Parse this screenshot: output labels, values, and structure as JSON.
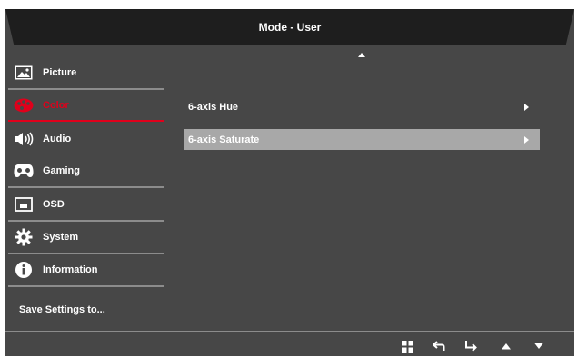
{
  "header": {
    "title": "Mode - User"
  },
  "sidebar": {
    "items": [
      {
        "label": "Picture",
        "icon": "picture-icon"
      },
      {
        "label": "Color",
        "icon": "color-palette-icon",
        "active": true
      },
      {
        "label": "Audio",
        "icon": "speaker-icon"
      },
      {
        "label": "Gaming",
        "icon": "gamepad-icon"
      },
      {
        "label": "OSD",
        "icon": "osd-window-icon"
      },
      {
        "label": "System",
        "icon": "gear-icon"
      },
      {
        "label": "Information",
        "icon": "info-icon"
      },
      {
        "label": "Save Settings to..."
      }
    ]
  },
  "content": {
    "items": [
      {
        "label": "6-axis Hue",
        "selected": false
      },
      {
        "label": "6-axis Saturate",
        "selected": true
      }
    ]
  },
  "footer": {
    "buttons": [
      "menu-grid-icon",
      "back-arrow-icon",
      "enter-arrow-icon",
      "up-triangle-icon",
      "down-triangle-icon"
    ]
  },
  "colors": {
    "accent": "#e0001b",
    "panel": "#474747",
    "header": "#1e1e1e",
    "selected": "#a8a8a8"
  }
}
